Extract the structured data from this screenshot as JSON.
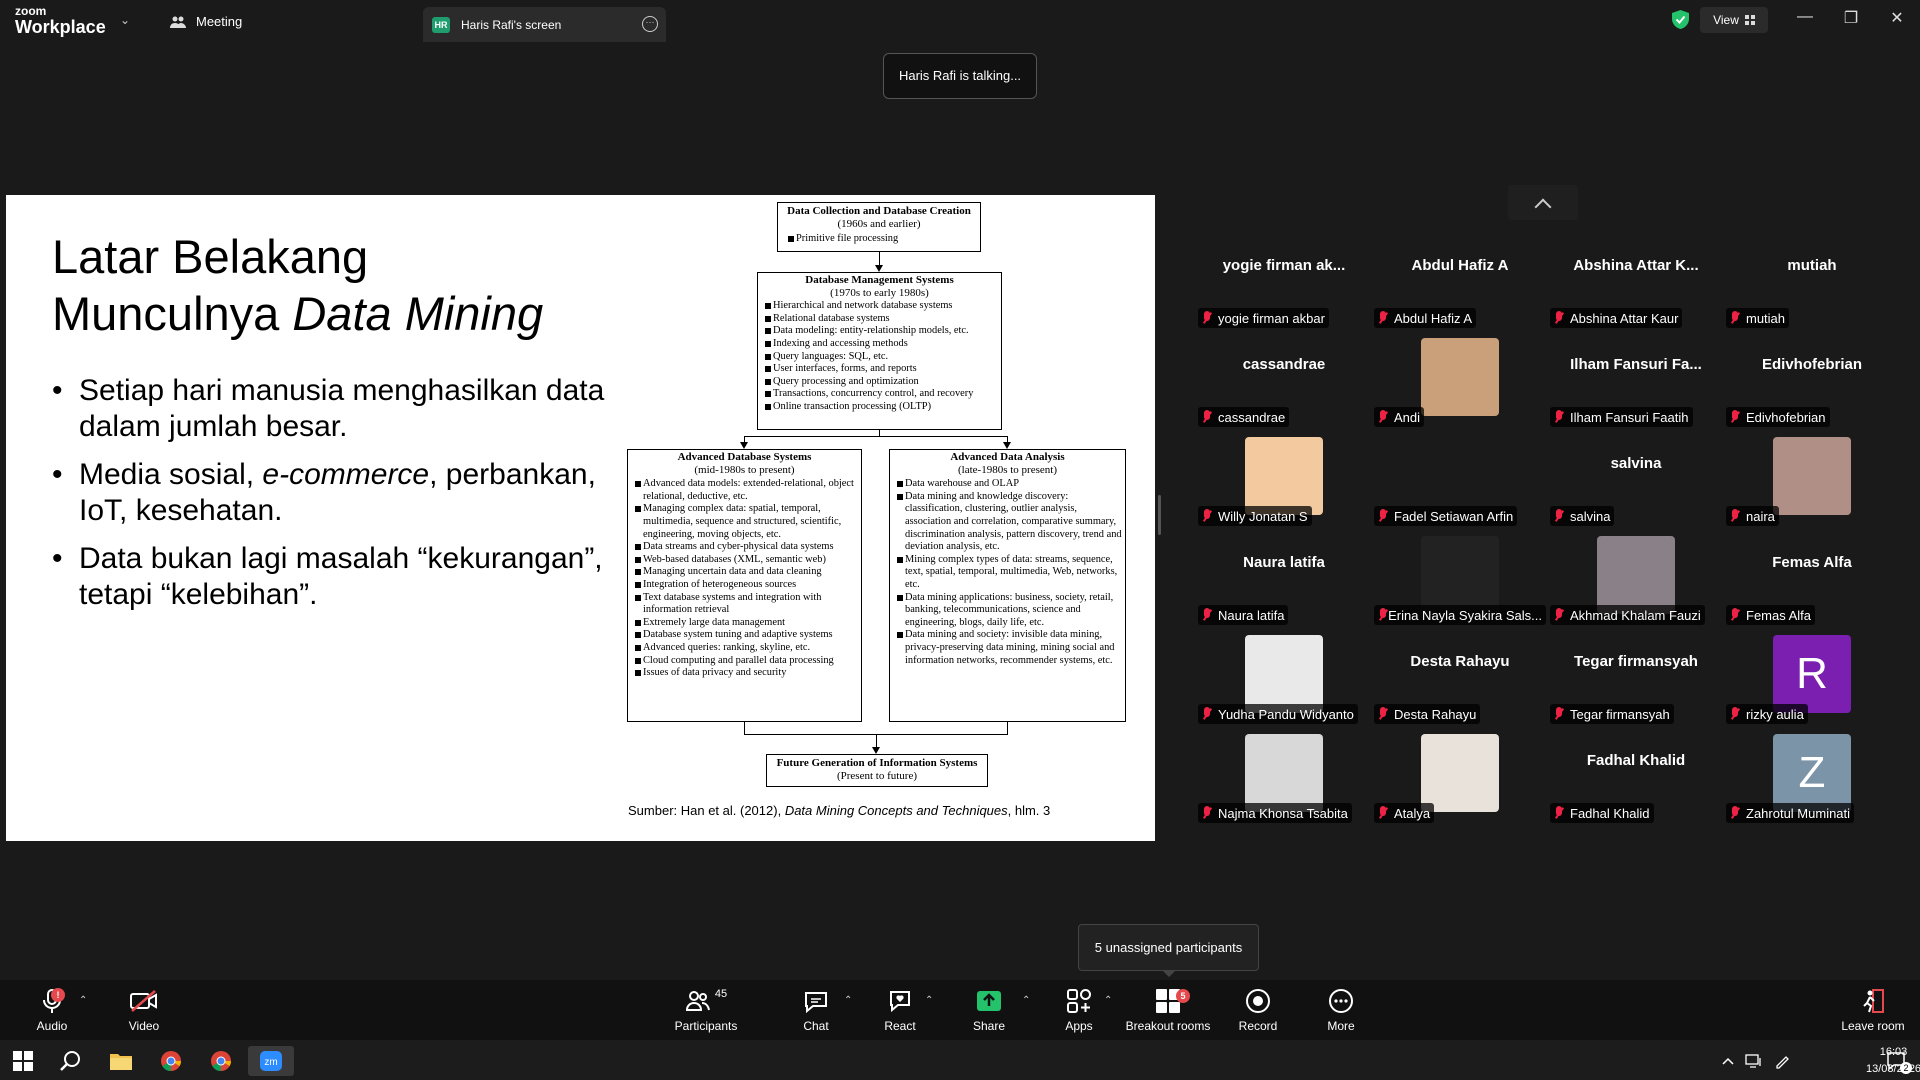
{
  "titlebar": {
    "brand_top": "zoom",
    "brand_bottom": "Workplace",
    "meeting_tab": "Meeting",
    "screen_tab_badge": "HR",
    "screen_tab": "Haris Rafi's screen",
    "view_label": "View"
  },
  "toast": "Haris Rafi is talking...",
  "slide": {
    "title_line1": "Latar Belakang",
    "title_line2_plain": "Munculnya ",
    "title_line2_italic": "Data Mining",
    "bullets": [
      {
        "parts": [
          "Setiap hari manusia menghasilkan data dalam jumlah besar."
        ]
      },
      {
        "pre": "Media sosial, ",
        "italic": "e-commerce",
        "post": ", perbankan, IoT, kesehatan."
      },
      {
        "parts": [
          "Data bukan lagi masalah “kekurangan”, tetapi “kelebihan”."
        ]
      }
    ],
    "source_pre": "Sumber: Han et al. (2012), ",
    "source_italic": "Data Mining Concepts and Techniques",
    "source_post": ", hlm. 3",
    "diagram": {
      "box1": {
        "title": "Data Collection and Database Creation",
        "sub": "(1960s and earlier)",
        "items": [
          "Primitive file processing"
        ]
      },
      "box2": {
        "title": "Database Management Systems",
        "sub": "(1970s to early 1980s)",
        "items": [
          "Hierarchical and network database systems",
          "Relational database systems",
          "Data modeling: entity-relationship models, etc.",
          "Indexing and accessing methods",
          "Query languages: SQL, etc.",
          "User interfaces, forms, and reports",
          "Query processing and optimization",
          "Transactions, concurrency control, and recovery",
          "Online transaction processing (OLTP)"
        ]
      },
      "box3": {
        "title": "Advanced Database Systems",
        "sub": "(mid-1980s to present)",
        "items": [
          "Advanced data models: extended-relational, object relational, deductive, etc.",
          "Managing complex data: spatial, temporal, multimedia, sequence and structured, scientific, engineering, moving objects, etc.",
          "Data streams and cyber-physical data systems",
          "Web-based databases (XML, semantic web)",
          "Managing uncertain data and data cleaning",
          "Integration of heterogeneous sources",
          "Text database systems and integration with information retrieval",
          "Extremely large data management",
          "Database system tuning and adaptive systems",
          "Advanced queries: ranking, skyline, etc.",
          "Cloud computing and parallel data processing",
          "Issues of data privacy and security"
        ]
      },
      "box4": {
        "title": "Advanced Data Analysis",
        "sub": "(late-1980s to present)",
        "items": [
          "Data warehouse and OLAP",
          "Data mining and knowledge discovery: classification, clustering, outlier analysis, association and correlation, comparative summary, discrimination analysis, pattern discovery, trend and deviation analysis, etc.",
          "Mining complex types of data: streams, sequence, text, spatial, temporal, multimedia, Web, networks, etc.",
          "Data mining applications: business, society, retail, banking, telecommunications, science and engineering, blogs, daily life, etc.",
          "Data mining and society: invisible data mining, privacy-preserving data mining, mining social and information networks, recommender systems, etc."
        ]
      },
      "box5": {
        "title": "Future Generation of Information Systems",
        "sub": "(Present to future)"
      }
    }
  },
  "participants": [
    {
      "name": "yogie firman ak...",
      "caption": "yogie firman akbar"
    },
    {
      "name": "Abdul Hafiz A",
      "caption": "Abdul Hafiz A"
    },
    {
      "name": "Abshina Attar K...",
      "caption": "Abshina Attar Kaur"
    },
    {
      "name": "mutiah",
      "caption": "mutiah"
    },
    {
      "name": "cassandrae",
      "caption": "cassandrae"
    },
    {
      "name": "",
      "caption": "Andi",
      "avatar": "photo",
      "color": "#c9a07a"
    },
    {
      "name": "Ilham Fansuri Fa...",
      "caption": "Ilham Fansuri Faatih"
    },
    {
      "name": "Edivhofebrian",
      "caption": "Edivhofebrian"
    },
    {
      "name": "",
      "caption": "Willy Jonatan S",
      "avatar": "photo",
      "color": "#f3c9a0"
    },
    {
      "name": "",
      "caption": "Fadel Setiawan Arfin"
    },
    {
      "name": "salvina",
      "caption": "salvina"
    },
    {
      "name": "",
      "caption": "naira",
      "avatar": "photo",
      "color": "#b08f87"
    },
    {
      "name": "Naura latifa",
      "caption": "Naura latifa"
    },
    {
      "name": "",
      "caption": "Erina Nayla Syakira Sals...",
      "avatar": "photo",
      "color": "#222222"
    },
    {
      "name": "",
      "caption": "Akhmad Khalam Fauzi",
      "avatar": "photo",
      "color": "#8a8088"
    },
    {
      "name": "Femas Alfa",
      "caption": "Femas Alfa"
    },
    {
      "name": "",
      "caption": "Yudha Pandu Widyanto",
      "avatar": "photo",
      "color": "#e9e9e9"
    },
    {
      "name": "Desta Rahayu",
      "caption": "Desta Rahayu"
    },
    {
      "name": "Tegar firmansyah",
      "caption": "Tegar firmansyah"
    },
    {
      "name": "",
      "caption": "rizky aulia",
      "avatar": "letter",
      "letter": "R",
      "color": "#7a1fb0"
    },
    {
      "name": "",
      "caption": "Najma Khonsa Tsabita",
      "avatar": "photo",
      "color": "#d8d8d8"
    },
    {
      "name": "",
      "caption": "Atalya",
      "avatar": "photo",
      "color": "#e8e2da"
    },
    {
      "name": "Fadhal Khalid",
      "caption": "Fadhal Khalid"
    },
    {
      "name": "",
      "caption": "Zahrotul Muminati",
      "avatar": "letter",
      "letter": "Z",
      "color": "#7b94a8"
    }
  ],
  "toolbar": {
    "audio": "Audio",
    "video": "Video",
    "participants": "Participants",
    "participants_count": "45",
    "chat": "Chat",
    "react": "React",
    "share": "Share",
    "apps": "Apps",
    "breakout": "Breakout rooms",
    "breakout_badge": "5",
    "record": "Record",
    "more": "More",
    "leave": "Leave room",
    "audio_badge": "!"
  },
  "breakout_tooltip": "5 unassigned participants",
  "taskbar": {
    "time": "16:03",
    "date": "13/03/2026",
    "notif_count": "2"
  },
  "colors": {
    "accent_green": "#1f9d6e",
    "share_green": "#23c26b",
    "danger": "#e5484d"
  }
}
